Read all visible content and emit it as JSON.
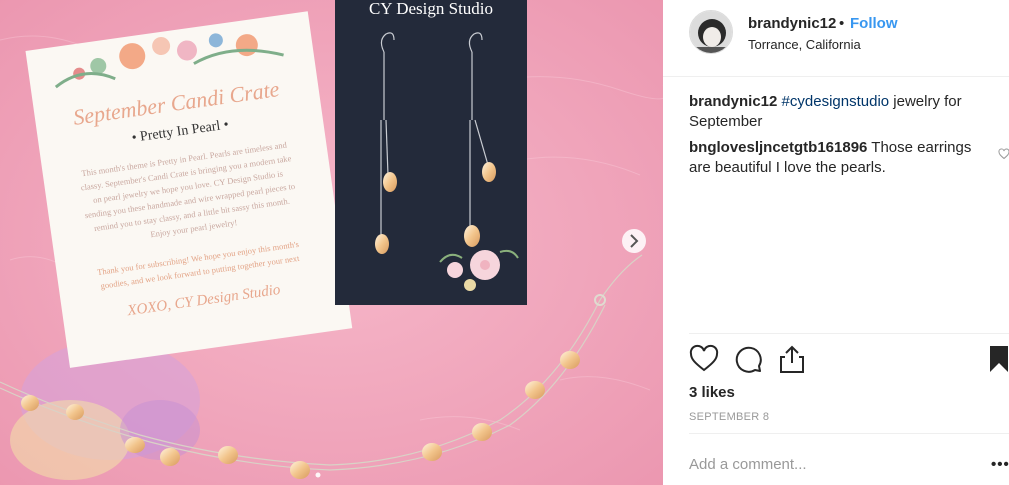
{
  "post": {
    "username": "brandynic12",
    "separator": "•",
    "follow_label": "Follow",
    "location": "Torrance, California",
    "caption_user": "brandynic12",
    "caption_hashtag": "#cydesignstudio",
    "caption_text": " jewelry for September",
    "likes": "3 likes",
    "date": "SEPTEMBER 8",
    "add_comment_placeholder": "Add a comment...",
    "more_options": "•••"
  },
  "comments": [
    {
      "user": "bnglovesljncetgtb161896",
      "text": " Those earrings are beautiful I love the pearls."
    }
  ],
  "photo": {
    "card_title": "CY Design Studio",
    "crate_title": "September Candi Crate",
    "crate_subtitle": "• Pretty In Pearl •",
    "crate_body": [
      "This month's theme is Pretty in Pearl. Pearls are timeless and",
      "classy. September's Candi Crate is bringing you a modern take",
      "on pearl jewelry we hope you love. CY Design Studio is",
      "sending you these handmade and wire wrapped pearl pieces to",
      "remind you to stay classy, and a little bit sassy this month.",
      "Enjoy your pearl jewelry!"
    ],
    "crate_thanks": [
      "Thank you for subscribing! We hope you enjoy this month's",
      "goodies, and we look forward to putting together your next"
    ],
    "crate_signoff": "XOXO, CY Design Studio"
  },
  "colors": {
    "link_blue": "#3897f0",
    "hashtag": "#003569",
    "background_pink": "#f0a3ba",
    "card_dark": "#232a3a"
  }
}
